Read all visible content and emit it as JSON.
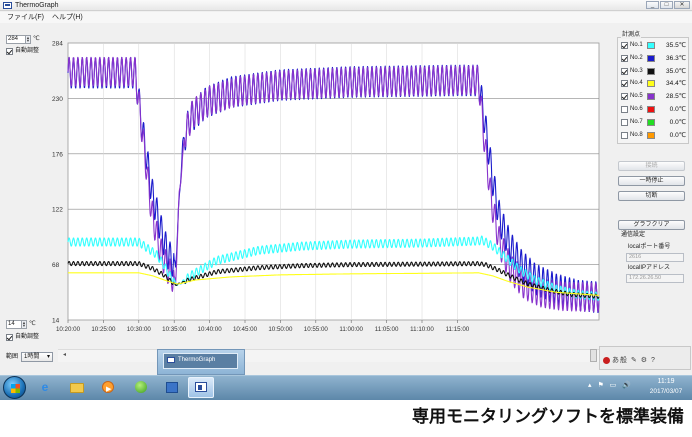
{
  "window": {
    "title": "ThermoGraph",
    "min": "_",
    "max": "□",
    "close": "✕"
  },
  "menu": {
    "file": "ファイル(F)",
    "help": "ヘルプ(H)"
  },
  "left": {
    "ymax_value": "284",
    "ymin_value": "14",
    "unit": "℃",
    "auto_label_top": "自動調整",
    "auto_label_bottom": "自動調整",
    "auto_top_checked": true,
    "auto_bottom_checked": true,
    "range_label": "範囲",
    "range_value": "1時間"
  },
  "legend": {
    "title": "計測点",
    "points": [
      {
        "name": "No.1",
        "color": "#33ffff",
        "value": "35.5℃",
        "checked": true
      },
      {
        "name": "No.2",
        "color": "#1a1acc",
        "value": "36.3℃",
        "checked": true
      },
      {
        "name": "No.3",
        "color": "#111111",
        "value": "35.0℃",
        "checked": true
      },
      {
        "name": "No.4",
        "color": "#ffff1a",
        "value": "34.4℃",
        "checked": true
      },
      {
        "name": "No.5",
        "color": "#8833cc",
        "value": "28.5℃",
        "checked": true
      },
      {
        "name": "No.6",
        "color": "#ee1111",
        "value": "0.0℃",
        "checked": false
      },
      {
        "name": "No.7",
        "color": "#22dd22",
        "value": "0.0℃",
        "checked": false
      },
      {
        "name": "No.8",
        "color": "#ff9900",
        "value": "0.0℃",
        "checked": false
      }
    ]
  },
  "buttons": {
    "resume": "接続",
    "pause": "一時停止",
    "disconnect": "切断",
    "clear": "グラフクリア"
  },
  "network": {
    "title": "通信設定",
    "port_label": "localポート番号",
    "port_value": "2616",
    "ip_label": "localIPアドレス",
    "ip_value": "172.26.26.50"
  },
  "taskbar": {
    "preview_title": "ThermoGraph",
    "ie_glyph": "e",
    "tray": "▴ ⚑ ▭ 🔊",
    "notif_icons": "あ般 ✎ ⚙ ?",
    "time": "11:19",
    "date": "2017/03/07"
  },
  "caption": "専用モニタリングソフトを標準装備",
  "chart_data": {
    "type": "line",
    "ylim": [
      14,
      284
    ],
    "yticks": [
      "284",
      "230",
      "176",
      "122",
      "68",
      "14"
    ],
    "xticks": [
      "10:20:00",
      "10:25:00",
      "10:30:00",
      "10:35:00",
      "10:40:00",
      "10:45:00",
      "10:50:00",
      "10:55:00",
      "11:00:00",
      "11:05:00",
      "11:10:00",
      "11:15:00"
    ],
    "grid": true,
    "xlabel": "",
    "ylabel": "",
    "series": [
      {
        "color": "#1a1acc",
        "ripple": 15,
        "points": [
          [
            0,
            255
          ],
          [
            9.5,
            255
          ],
          [
            10.5,
            200
          ],
          [
            11.8,
            140
          ],
          [
            13,
            105
          ],
          [
            14,
            80
          ],
          [
            15.2,
            66
          ],
          [
            15.6,
            118
          ],
          [
            16.2,
            185
          ],
          [
            17.2,
            210
          ],
          [
            19.5,
            226
          ],
          [
            23,
            236
          ],
          [
            30,
            243
          ],
          [
            40,
            246
          ],
          [
            50,
            247
          ],
          [
            55,
            247.5
          ],
          [
            58,
            247.5
          ],
          [
            59,
            200
          ],
          [
            60,
            150
          ],
          [
            61,
            112
          ],
          [
            62.5,
            85
          ],
          [
            64,
            68
          ],
          [
            66,
            54
          ],
          [
            69,
            44
          ],
          [
            72,
            38
          ],
          [
            75,
            36
          ]
        ]
      },
      {
        "color": "#8833cc",
        "ripple": 14,
        "points": [
          [
            0,
            256
          ],
          [
            9.5,
            256
          ],
          [
            10.6,
            190
          ],
          [
            11.8,
            120
          ],
          [
            13,
            82
          ],
          [
            14.2,
            62
          ],
          [
            15.2,
            50
          ],
          [
            15.7,
            135
          ],
          [
            16.5,
            195
          ],
          [
            17.6,
            215
          ],
          [
            20,
            228
          ],
          [
            24,
            237
          ],
          [
            30,
            243
          ],
          [
            40,
            246
          ],
          [
            50,
            247
          ],
          [
            58,
            248
          ],
          [
            58.8,
            190
          ],
          [
            59.8,
            130
          ],
          [
            61,
            88
          ],
          [
            62.5,
            64
          ],
          [
            64.5,
            48
          ],
          [
            67,
            40
          ],
          [
            70,
            37
          ],
          [
            75,
            36
          ]
        ]
      },
      {
        "color": "#33ffff",
        "ripple": 4,
        "points": [
          [
            0,
            90
          ],
          [
            10,
            90
          ],
          [
            11.2,
            84
          ],
          [
            12.5,
            78
          ],
          [
            13.5,
            68
          ],
          [
            14.5,
            56
          ],
          [
            15.5,
            48
          ],
          [
            17.5,
            58
          ],
          [
            21,
            72
          ],
          [
            27,
            82
          ],
          [
            33,
            86
          ],
          [
            40,
            88
          ],
          [
            50,
            89
          ],
          [
            58,
            91
          ],
          [
            58.5,
            92
          ],
          [
            60,
            86
          ],
          [
            62,
            74
          ],
          [
            64,
            62
          ],
          [
            66,
            53
          ],
          [
            69,
            44
          ],
          [
            72,
            39
          ],
          [
            75,
            37
          ]
        ]
      },
      {
        "color": "#111111",
        "ripple": 2,
        "points": [
          [
            0,
            69
          ],
          [
            10,
            69
          ],
          [
            12,
            64
          ],
          [
            13.5,
            58
          ],
          [
            14.5,
            52
          ],
          [
            15.2,
            48
          ],
          [
            17,
            53
          ],
          [
            21,
            61
          ],
          [
            27,
            65
          ],
          [
            33,
            67
          ],
          [
            40,
            68
          ],
          [
            50,
            68.5
          ],
          [
            58,
            69
          ],
          [
            59,
            68
          ],
          [
            61,
            62
          ],
          [
            63,
            55
          ],
          [
            65,
            49
          ],
          [
            68,
            43
          ],
          [
            71,
            39
          ],
          [
            75,
            37
          ]
        ]
      },
      {
        "color": "#ffff1a",
        "ripple": 0,
        "points": [
          [
            0,
            60
          ],
          [
            10,
            60
          ],
          [
            12,
            57
          ],
          [
            14,
            52
          ],
          [
            15.5,
            49
          ],
          [
            18,
            53
          ],
          [
            23,
            56
          ],
          [
            30,
            58
          ],
          [
            40,
            59
          ],
          [
            50,
            59.5
          ],
          [
            58,
            60
          ],
          [
            60,
            57
          ],
          [
            62,
            52
          ],
          [
            65,
            46
          ],
          [
            69,
            41
          ],
          [
            75,
            38
          ]
        ]
      }
    ]
  }
}
